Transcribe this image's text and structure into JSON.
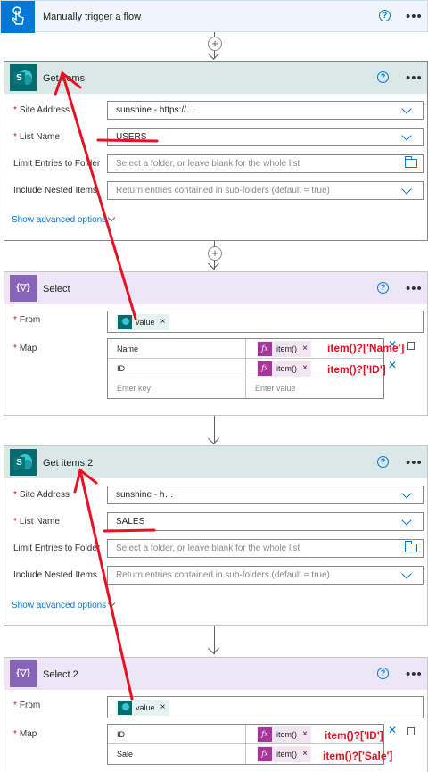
{
  "trigger": {
    "title": "Manually trigger a flow",
    "help": "?",
    "more": "•••"
  },
  "get_items": {
    "title": "Get items",
    "help": "?",
    "more": "•••",
    "fields": [
      {
        "label": "Site Address",
        "required": true,
        "value": "sunshine - https://…"
      },
      {
        "label": "List Name",
        "required": true,
        "value": "USERS"
      },
      {
        "label": "Limit Entries to Folder",
        "required": false,
        "placeholder": "Select a folder, or leave blank for the whole list"
      },
      {
        "label": "Include Nested Items",
        "required": false,
        "placeholder": "Return entries contained in sub-folders (default = true)"
      }
    ],
    "advanced": "Show advanced options"
  },
  "select": {
    "title": "Select",
    "help": "?",
    "more": "•••",
    "from_label": "From",
    "from_token": "value",
    "map_label": "Map",
    "rows": [
      {
        "key": "Name",
        "token": "item()"
      },
      {
        "key": "ID",
        "token": "item()"
      }
    ],
    "key_placeholder": "Enter key",
    "value_placeholder": "Enter value"
  },
  "get_items_2": {
    "title": "Get items 2",
    "help": "?",
    "more": "•••",
    "fields": [
      {
        "label": "Site Address",
        "required": true,
        "value": "sunshine - h…"
      },
      {
        "label": "List Name",
        "required": true,
        "value": "SALES"
      },
      {
        "label": "Limit Entries to Folder",
        "required": false,
        "placeholder": "Select a folder, or leave blank for the whole list"
      },
      {
        "label": "Include Nested Items",
        "required": false,
        "placeholder": "Return entries contained in sub-folders (default = true)"
      }
    ],
    "advanced": "Show advanced options"
  },
  "select_2": {
    "title": "Select 2",
    "help": "?",
    "more": "•••",
    "from_label": "From",
    "from_token": "value",
    "map_label": "Map",
    "rows": [
      {
        "key": "ID",
        "token": "item()"
      },
      {
        "key": "Sale",
        "token": "item()"
      }
    ]
  },
  "annotations": {
    "a1": "item()?['Name']",
    "a2": "item()?['ID']",
    "a3": "item()?['ID']",
    "a4": "item()?['Sale']"
  },
  "colors": {
    "accent": "#0078d4",
    "annotation": "#e81123",
    "select": "#8764b8",
    "sharepoint": "#036c70"
  },
  "icons": {
    "trigger": "touch-icon",
    "sharepoint": "sharepoint-icon",
    "select": "data-operation-icon",
    "fx": "expression-icon"
  }
}
